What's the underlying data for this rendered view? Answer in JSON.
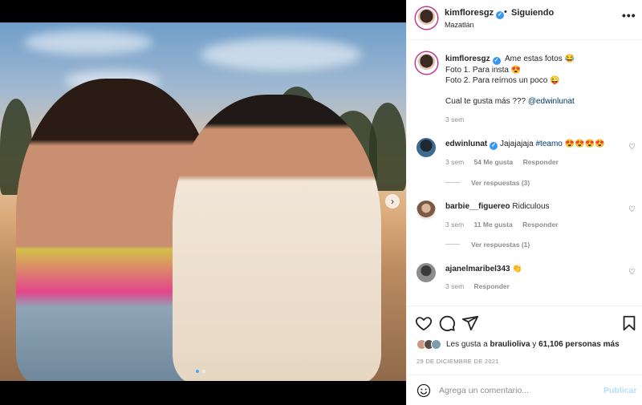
{
  "post": {
    "username": "kimfloresgz",
    "dot": "•",
    "follow_status": "Siguiendo",
    "location": "Mazatlán",
    "more": "•••",
    "carousel_next": "›"
  },
  "caption": {
    "username": "kimfloresgz",
    "line1": "Ame estas fotos 😂",
    "line2": "Foto 1. Para insta 😍",
    "line3": "Foto 2. Para reírnos un poco 😜",
    "line4_text": "Cual te gusta más ??? ",
    "line4_mention": "@edwinlunat",
    "time": "3 sem"
  },
  "comments": [
    {
      "username": "edwinlunat",
      "text_plain": "Jajajajaja ",
      "text_tag": "#teamo",
      "text_emoji": " 😍😍😍😍",
      "time": "3 sem",
      "likes": "54 Me gusta",
      "reply": "Responder",
      "view_replies": "Ver respuestas (3)"
    },
    {
      "username": "barbie__figuereo",
      "text_plain": "Ridiculous",
      "time": "3 sem",
      "likes": "11 Me gusta",
      "reply": "Responder",
      "view_replies": "Ver respuestas (1)"
    },
    {
      "username": "ajanelmaribel343",
      "text_plain": "👏",
      "time": "3 sem",
      "reply": "Responder"
    }
  ],
  "likes": {
    "prefix": "Les gusta a ",
    "user": "braulioliva",
    "middle": " y ",
    "count": "61,106 personas más"
  },
  "date": "29 DE DICIEMBRE DE 2021",
  "add_comment": {
    "placeholder": "Agrega un comentario...",
    "publish": "Publicar"
  },
  "icons": {
    "like": "heart-icon",
    "comment": "comment-icon",
    "share": "paper-plane-icon",
    "save": "bookmark-icon",
    "emoji": "smiley-icon"
  },
  "colors": {
    "verified": "#3897f0",
    "mention": "#00376b",
    "muted": "#8e8e8e",
    "publish": "#b2dffc"
  }
}
